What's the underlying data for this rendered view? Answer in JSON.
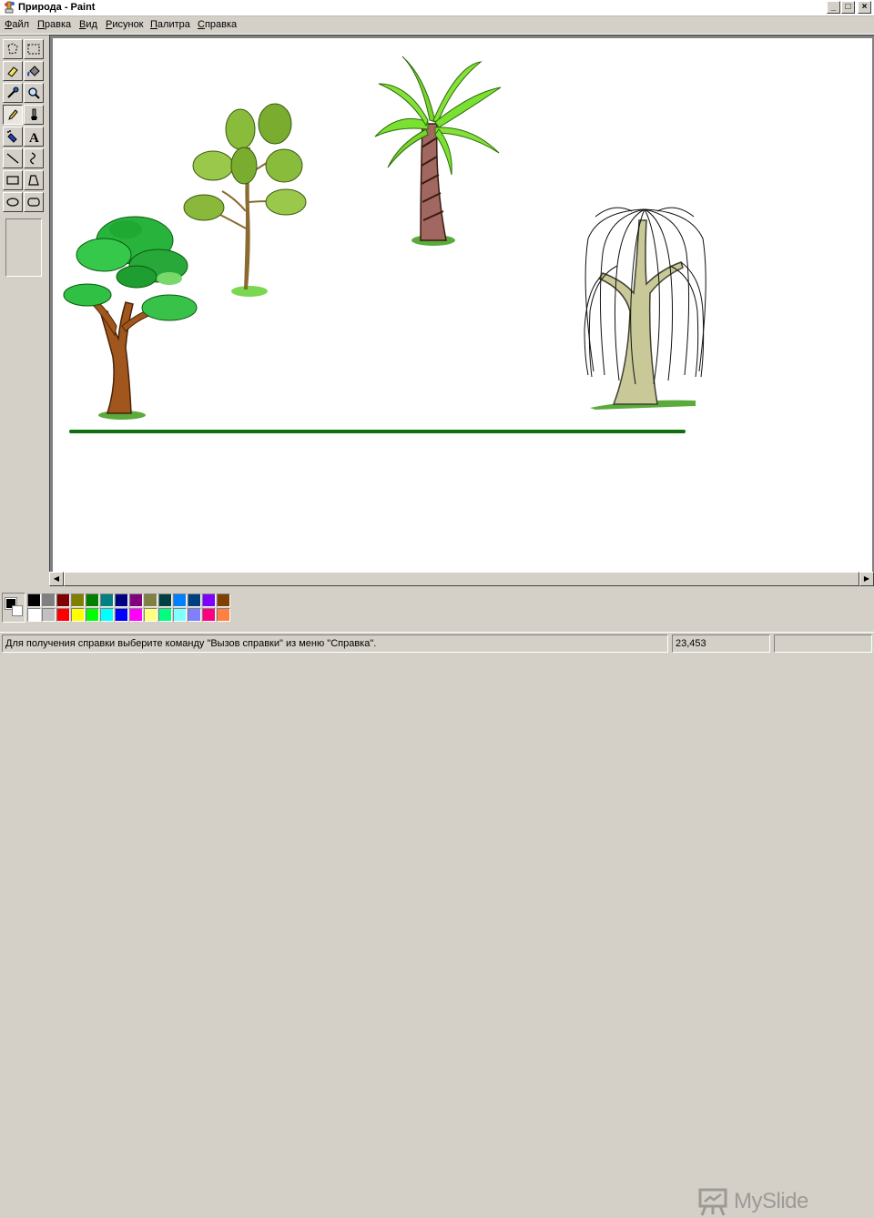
{
  "window": {
    "title": "Природа - Paint",
    "caption_buttons": [
      "_",
      "□",
      "×"
    ]
  },
  "menu": [
    "Файл",
    "Правка",
    "Вид",
    "Рисунок",
    "Палитра",
    "Справка"
  ],
  "tools": [
    {
      "name": "free-select-icon"
    },
    {
      "name": "rect-select-icon"
    },
    {
      "name": "eraser-icon"
    },
    {
      "name": "fill-bucket-icon"
    },
    {
      "name": "color-picker-icon"
    },
    {
      "name": "magnifier-icon"
    },
    {
      "name": "pencil-icon",
      "active": true
    },
    {
      "name": "brush-icon"
    },
    {
      "name": "airbrush-icon"
    },
    {
      "name": "text-icon",
      "glyph": "A"
    },
    {
      "name": "line-icon"
    },
    {
      "name": "curve-icon"
    },
    {
      "name": "rectangle-icon"
    },
    {
      "name": "polygon-icon"
    },
    {
      "name": "ellipse-icon"
    },
    {
      "name": "rounded-rect-icon"
    }
  ],
  "palette": {
    "foreground": "#000000",
    "background": "#ffffff",
    "colors_top": [
      "#000000",
      "#808080",
      "#800000",
      "#808000",
      "#008000",
      "#008080",
      "#000080",
      "#800080",
      "#808040",
      "#004040",
      "#0080ff",
      "#004080",
      "#8000ff",
      "#804000"
    ],
    "colors_bottom": [
      "#ffffff",
      "#c0c0c0",
      "#ff0000",
      "#ffff00",
      "#00ff00",
      "#00ffff",
      "#0000ff",
      "#ff00ff",
      "#ffff80",
      "#00ff80",
      "#80ffff",
      "#8080ff",
      "#ff0080",
      "#ff8040"
    ]
  },
  "watermark": "MySlide",
  "status": {
    "help_text": "Для получения справки выберите команду \"Вызов справки\" из меню \"Справка\".",
    "coords": "23,453",
    "size": ""
  }
}
